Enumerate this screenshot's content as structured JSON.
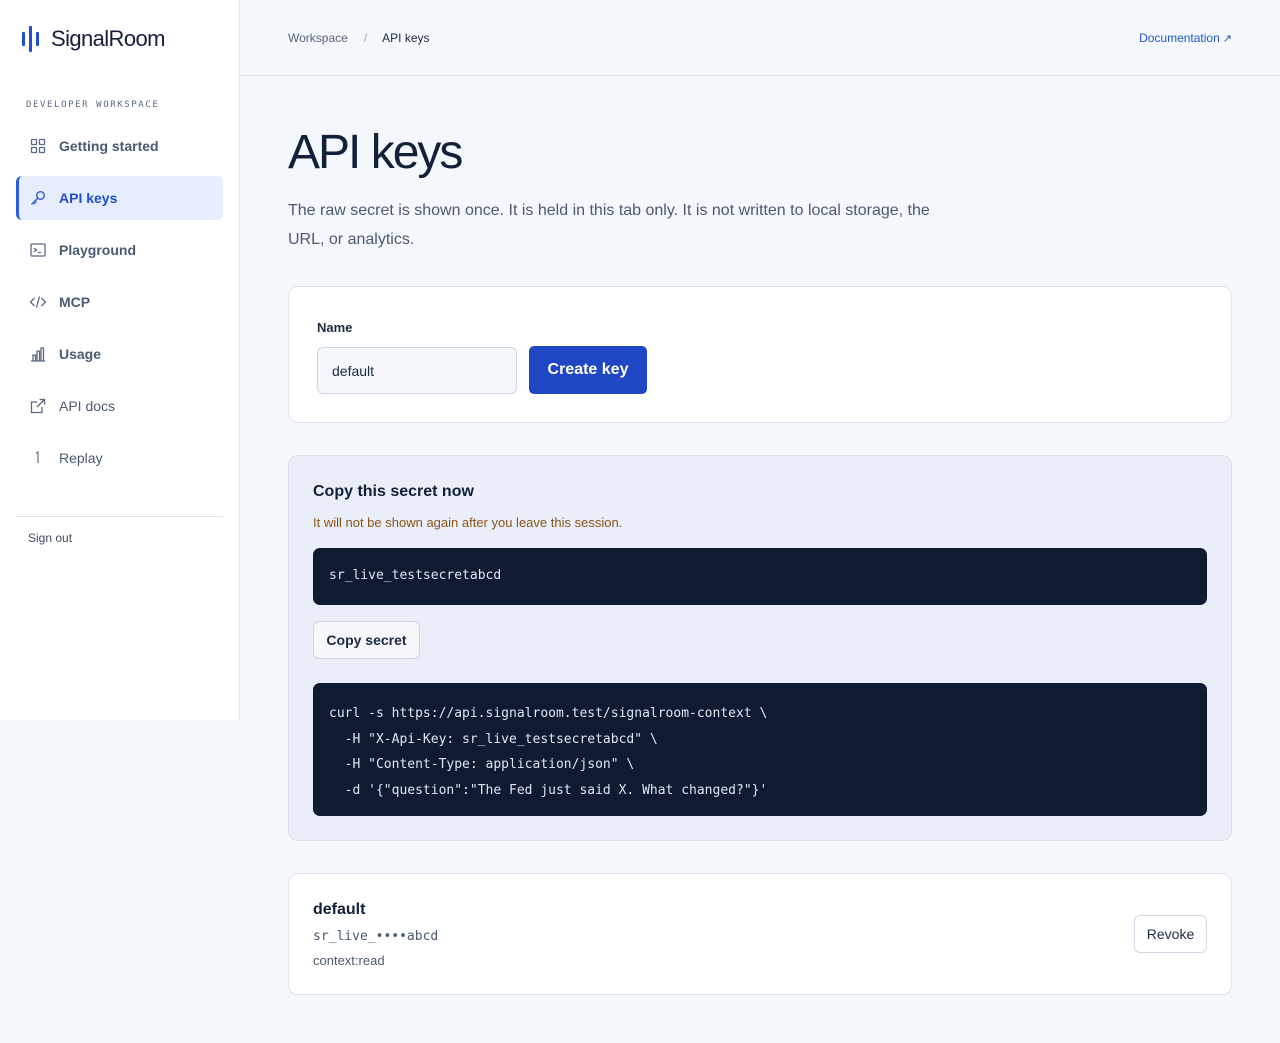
{
  "brand": {
    "name": "SignalRoom",
    "accent": "#1f4fcf"
  },
  "sidebar": {
    "section_label": "DEVELOPER WORKSPACE",
    "items": [
      {
        "label": "Getting started",
        "icon": "grid-icon",
        "active": false
      },
      {
        "label": "API keys",
        "icon": "key-icon",
        "active": true
      },
      {
        "label": "Playground",
        "icon": "terminal-icon",
        "active": false
      },
      {
        "label": "MCP",
        "icon": "code-icon",
        "active": false
      },
      {
        "label": "Usage",
        "icon": "bar-chart-icon",
        "active": false
      },
      {
        "label": "API docs",
        "icon": "external-link-icon",
        "active": false
      },
      {
        "label": "Replay",
        "icon": "replay-icon",
        "active": false
      }
    ],
    "sign_out": "Sign out"
  },
  "header": {
    "breadcrumb": [
      "Workspace",
      "API keys"
    ],
    "separator": "/",
    "docs_link": "Documentation",
    "docs_icon": "↗"
  },
  "main": {
    "title": "API keys",
    "description": "The raw secret is shown once. It is held in this tab only. It is not written to local storage, the URL, or analytics.",
    "create": {
      "name_label": "Name",
      "name_value": "default",
      "button": "Create key"
    },
    "secret": {
      "title": "Copy this secret now",
      "warning": "It will not be shown again after you leave this session.",
      "value": "sr_live_testsecretabcd",
      "copy_button": "Copy secret",
      "curl_lines": [
        "curl -s https://api.signalroom.test/signalroom-context \\",
        "  -H \"X-Api-Key: sr_live_testsecretabcd\" \\",
        "  -H \"Content-Type: application/json\" \\",
        "  -d '{\"question\":\"The Fed just said X. What changed?\"}'"
      ]
    },
    "keys": [
      {
        "name": "default",
        "masked": "sr_live_••••abcd",
        "scope": "context:read",
        "revoke": "Revoke"
      }
    ]
  },
  "colors": {
    "primary": "#1f47c3",
    "code_bg": "#0f1b33",
    "warning": "#8a5418",
    "active_bg": "#e6eefd"
  }
}
